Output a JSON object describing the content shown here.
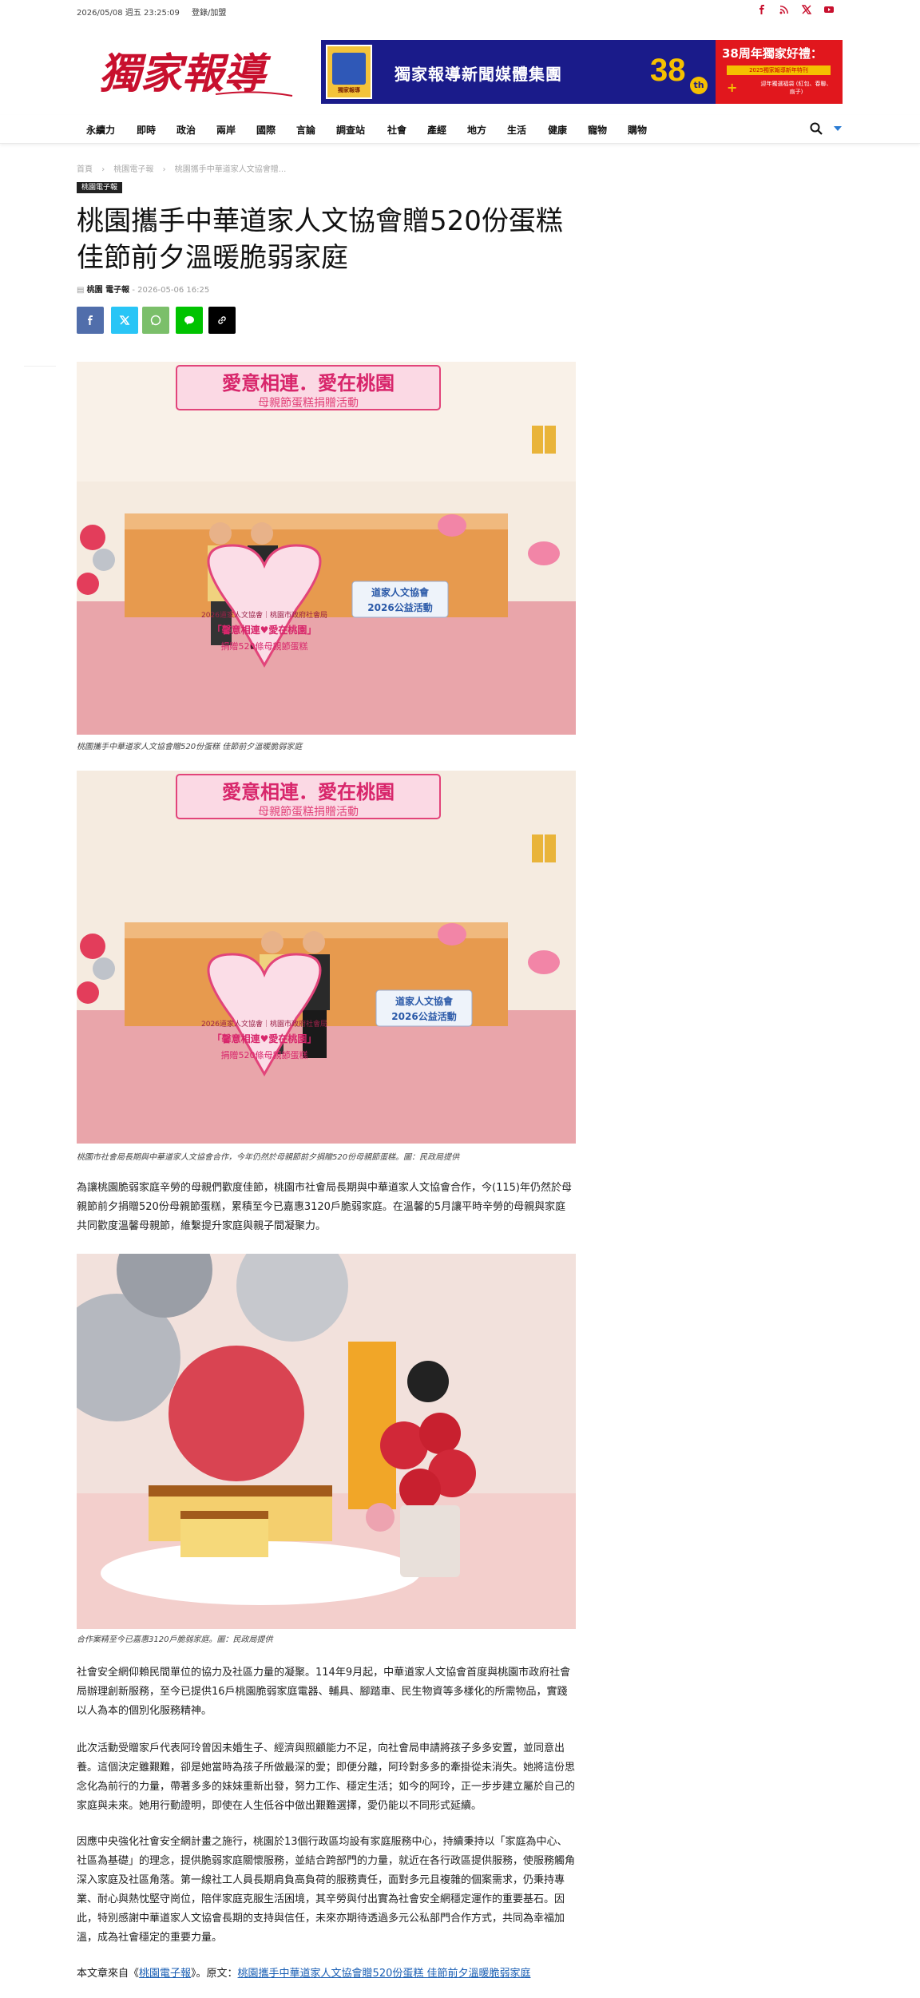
{
  "topbar": {
    "date": "2026/05/08 週五 23:25:09",
    "login": "登錄/加盟",
    "social": [
      "facebook-icon",
      "rss-icon",
      "x-icon",
      "youtube-icon"
    ],
    "social_color": "#c8102e"
  },
  "logo": {
    "text": "獨家報導",
    "color": "#c8102e"
  },
  "banner": {
    "left_caption": "獨家報導",
    "title": "獨家報導新聞媒體集團",
    "anniversary_num": "38",
    "anniversary_suffix": "th",
    "right_heading": "38周年獨家好禮：",
    "right_sub1": "2025獨家報導新年特刊",
    "right_plus": "+",
    "right_sub2": "迎年獨選福袋 (紅包、春聯、扇子)"
  },
  "nav": {
    "items": [
      "永續力",
      "即時",
      "政治",
      "兩岸",
      "國際",
      "言論",
      "調查站",
      "社會",
      "產經",
      "地方",
      "生活",
      "健康",
      "寵物",
      "購物"
    ]
  },
  "breadcrumb": [
    "首頁",
    "›",
    "桃園電子報",
    "›",
    "桃園攜手中華道家人文協會贈..."
  ],
  "article": {
    "category": "桃園電子報",
    "title": "桃園攜手中華道家人文協會贈520份蛋糕 佳節前夕溫暖脆弱家庭",
    "author": "桃園 電子報",
    "date": "2026-05-06 16:25",
    "share_buttons": [
      "facebook-icon",
      "x-icon",
      "whatsapp-icon",
      "line-icon",
      "link-icon"
    ],
    "share_colors": [
      "#516eab",
      "#29c5f6",
      "#7bbf6a",
      "#00c300",
      "#000000"
    ],
    "photo1_caption": "桃園攜手中華道家人文協會贈520份蛋糕 佳節前夕溫暖脆弱家庭",
    "photo2_caption": "桃園市社會局長期與中華道家人文協會合作，今年仍然於母親節前夕捐贈520份母親節蛋糕。圖：民政局提供",
    "para1": "為讓桃園脆弱家庭辛勞的母親們歡度佳節，桃園市社會局長期與中華道家人文協會合作，今(115)年仍然於母親節前夕捐贈520份母親節蛋糕，累積至今已嘉惠3120戶脆弱家庭。在溫馨的5月讓平時辛勞的母親與家庭共同歡度溫馨母親節，維繫提升家庭與親子間凝聚力。",
    "photo3_caption": "合作案精至今已嘉惠3120戶脆弱家庭。圖：民政局提供",
    "para2": "社會安全網仰賴民間單位的協力及社區力量的凝聚。114年9月起，中華道家人文協會首度與桃園市政府社會局辦理創新服務，至今已提供16戶桃園脆弱家庭電器、輔具、腳踏車、民生物資等多樣化的所需物品，實踐以人為本的個別化服務精神。",
    "para3": "此次活動受贈家戶代表阿玲曾因未婚生子、經濟與照顧能力不足，向社會局申請將孩子多多安置，並同意出養。這個決定雖艱難，卻是她當時為孩子所做最深的愛；即便分離，阿玲對多多的牽掛從未消失。她將這份思念化為前行的力量，帶著多多的妹妹重新出發，努力工作、穩定生活；如今的阿玲，正一步步建立屬於自己的家庭與未來。她用行動證明，即使在人生低谷中做出艱難選擇，愛仍能以不同形式延續。",
    "para4": "因應中央強化社會安全網計畫之施行，桃園於13個行政區均設有家庭服務中心，持續秉持以「家庭為中心、社區為基礎」的理念，提供脆弱家庭關懷服務，並結合跨部門的力量，就近在各行政區提供服務，使服務觸角深入家庭及社區角落。第一線社工人員長期肩負高負荷的服務責任，面對多元且複雜的個案需求，仍秉持專業、耐心與熱忱堅守崗位，陪伴家庭克服生活困境，其辛勞與付出實為社會安全網穩定運作的重要基石。因此，特別感謝中華道家人文協會長期的支持與信任，未來亦期待透過多元公私部門合作方式，共同為幸福加溫，成為社會穩定的重要力量。",
    "source_prefix": "本文章來自《",
    "source_name": "桃園電子報",
    "source_mid": "》。原文：",
    "source_link": "桃園攜手中華道家人文協會贈520份蛋糕 佳節前夕溫暖脆弱家庭"
  },
  "photo_scene": {
    "banner_text": "愛意相連．愛在桃園",
    "banner_sub": "母親節蛋糕捐贈活動",
    "heart_line1": "2026道家人文協會｜桃園市政府社會局",
    "heart_line2": "「馨意相連♥愛在桃園」",
    "heart_line3": "捐贈520條母親節蛋糕",
    "sign_line1": "道家人文協會",
    "sign_line2": "2026公益活動"
  }
}
